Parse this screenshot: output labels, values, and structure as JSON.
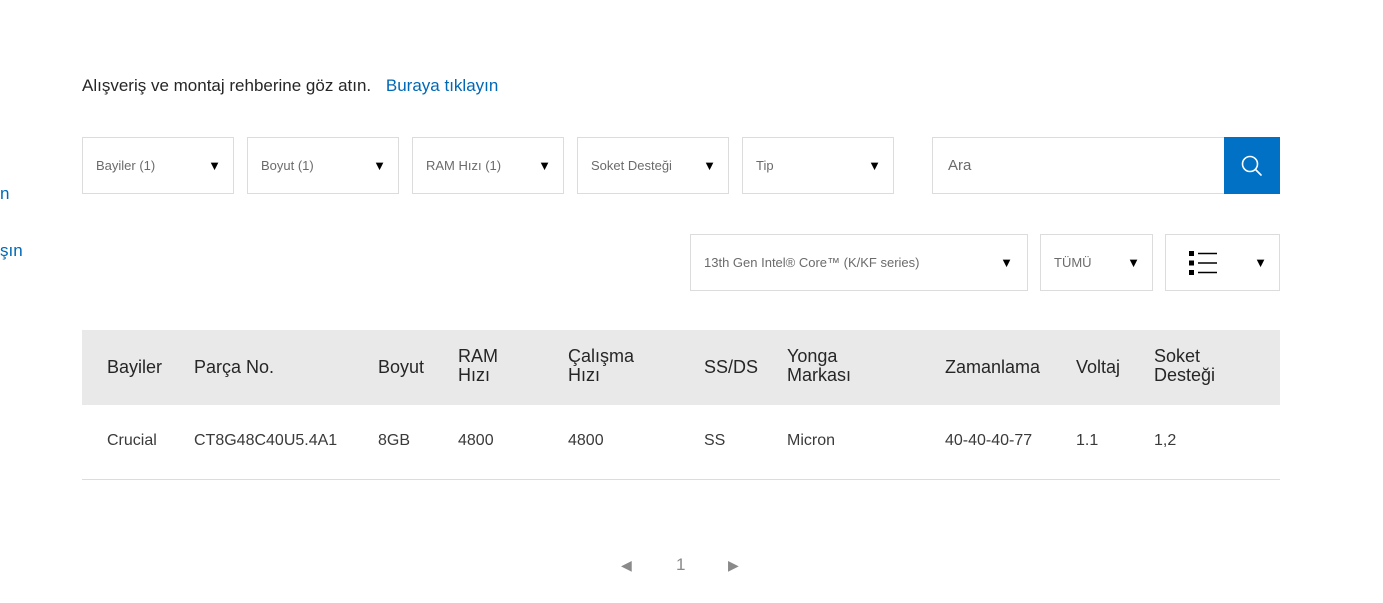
{
  "side_links": [
    "n",
    "şın"
  ],
  "intro": {
    "text": "Alışveriş ve montaj rehberine göz atın.",
    "link": "Buraya tıklayın"
  },
  "filters": [
    {
      "label": "Bayiler (1)"
    },
    {
      "label": "Boyut (1)"
    },
    {
      "label": "RAM Hızı (1)"
    },
    {
      "label": "Soket Desteği"
    },
    {
      "label": "Tip"
    }
  ],
  "search": {
    "placeholder": "Ara"
  },
  "selectors": {
    "processor": "13th Gen Intel® Core™ (K/KF series)",
    "scope": "TÜMÜ"
  },
  "table": {
    "headers": [
      "Bayiler",
      "Parça No.",
      "Boyut",
      "RAM Hızı",
      "Çalışma Hızı",
      "SS/DS",
      "Yonga Markası",
      "Zamanlama",
      "Voltaj",
      "Soket Desteği"
    ],
    "rows": [
      [
        "Crucial",
        "CT8G48C40U5.4A1",
        "8GB",
        "4800",
        "4800",
        "SS",
        "Micron",
        "40-40-40-77",
        "1.1",
        "1,2"
      ]
    ]
  },
  "pagination": {
    "current": "1"
  },
  "colors": {
    "accent": "#0071c5",
    "link": "#0068b5",
    "header_bg": "#e9e9e9"
  }
}
